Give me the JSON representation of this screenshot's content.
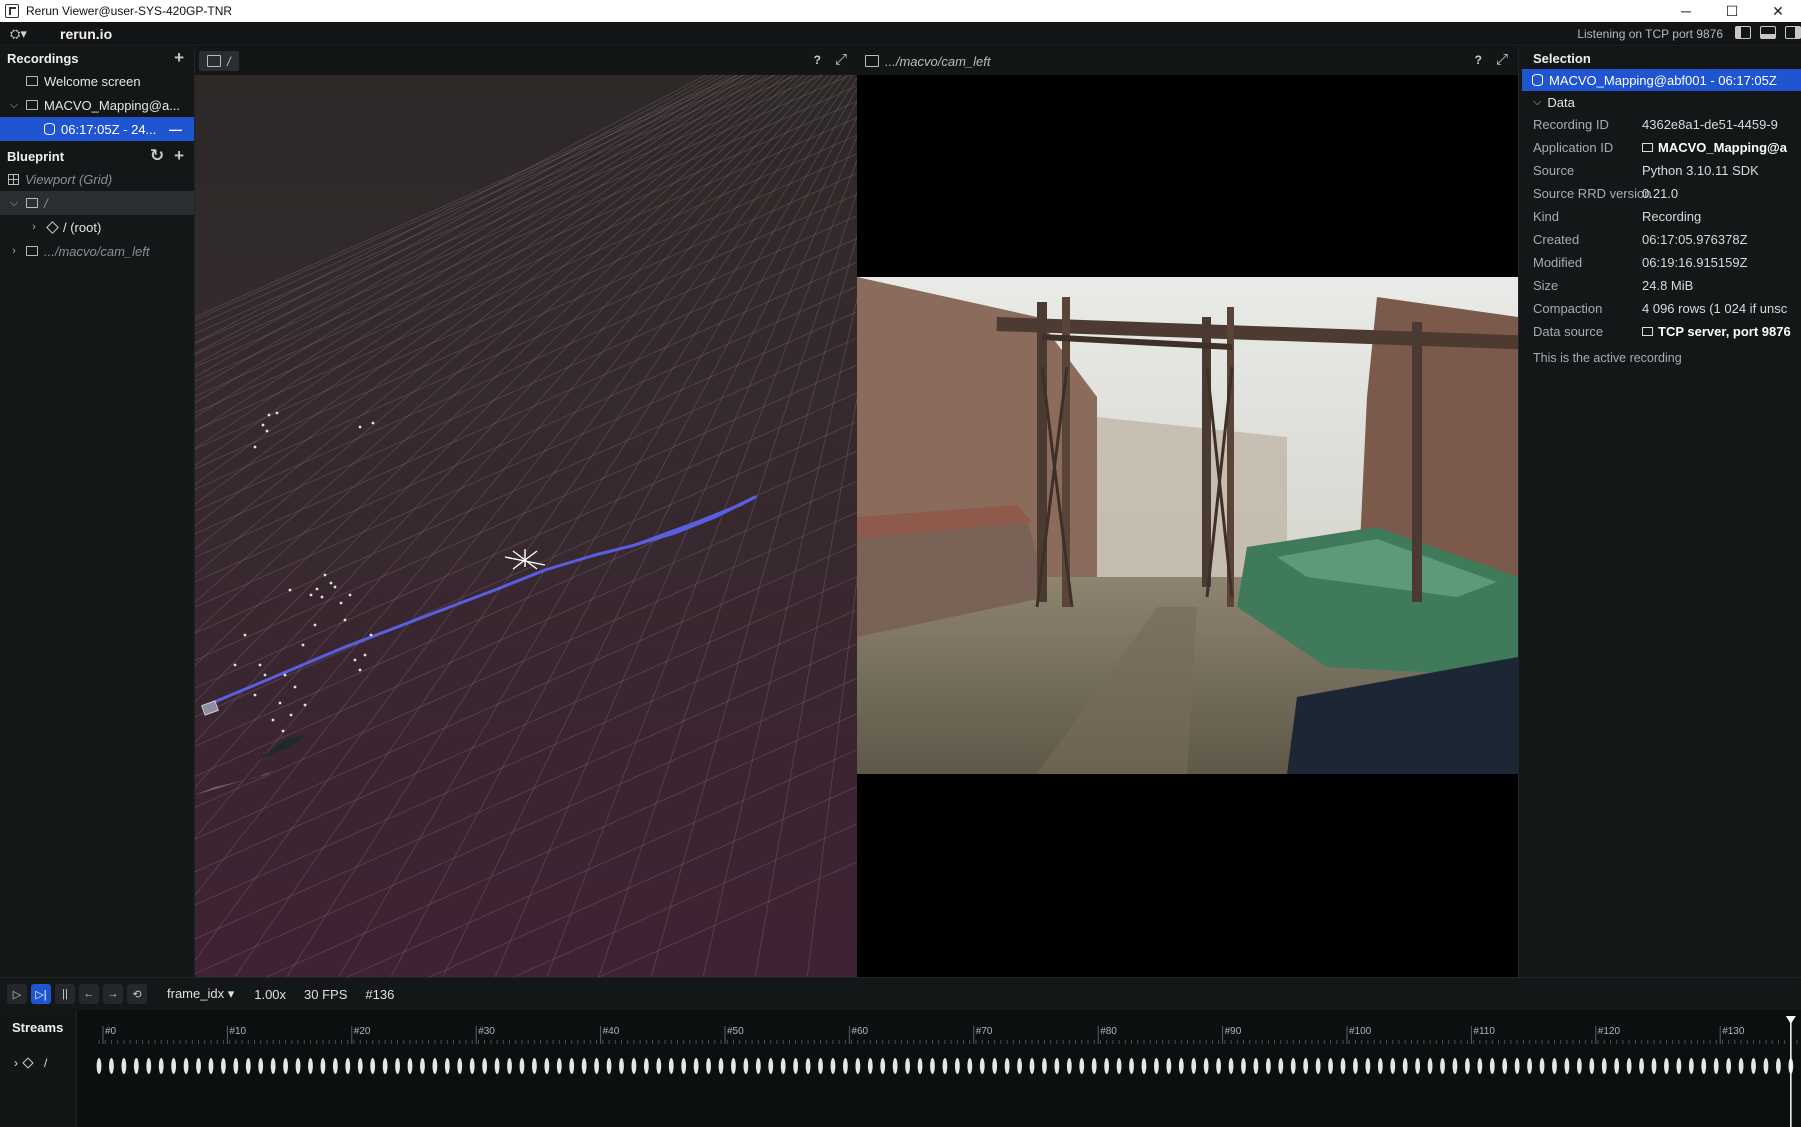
{
  "window": {
    "title": "Rerun Viewer@user-SYS-420GP-TNR",
    "minimize": "─",
    "maximize": "☐",
    "close": "✕"
  },
  "topbar": {
    "brand": "rerun.io",
    "logo_glyph": "⛭▾",
    "status": "Listening on TCP port 9876"
  },
  "recordings": {
    "title": "Recordings",
    "add_glyph": "+",
    "items": [
      {
        "label": "Welcome screen"
      },
      {
        "label": "MACVO_Mapping@a..."
      },
      {
        "label": "06:17:05Z - 24...",
        "trail": "—"
      }
    ]
  },
  "blueprint": {
    "title": "Blueprint",
    "reset_glyph": "↻",
    "add_glyph": "+",
    "viewport": "Viewport (Grid)",
    "items": [
      {
        "label": "/"
      },
      {
        "label": "/ (root)"
      },
      {
        "label": ".../macvo/cam_left"
      }
    ]
  },
  "views": {
    "spatial3d": {
      "tab_label": "/",
      "help": "?",
      "expand": "⤢"
    },
    "camera": {
      "tab_label": ".../macvo/cam_left",
      "help": "?",
      "expand": "⤢"
    }
  },
  "selection": {
    "title": "Selection",
    "selected": "MACVO_Mapping@abf001 - 06:17:05Z",
    "data_header": "Data",
    "properties": [
      {
        "key": "Recording ID",
        "value": "4362e8a1-de51-4459-9"
      },
      {
        "key": "Application ID",
        "value": "MACVO_Mapping@a"
      },
      {
        "key": "Source",
        "value": "Python 3.10.11 SDK"
      },
      {
        "key": "Source RRD version",
        "value": "0.21.0"
      },
      {
        "key": "Kind",
        "value": "Recording"
      },
      {
        "key": "Created",
        "value": "06:17:05.976378Z"
      },
      {
        "key": "Modified",
        "value": "06:19:16.915159Z"
      },
      {
        "key": "Size",
        "value": "24.8 MiB"
      },
      {
        "key": "Compaction",
        "value": "4 096 rows (1 024 if unsc"
      },
      {
        "key": "Data source",
        "value": "TCP server, port 9876"
      }
    ],
    "active_note": "This is the active recording"
  },
  "timeline": {
    "timeline_name": "frame_idx",
    "speed": "1.00x",
    "fps": "30 FPS",
    "current": "#136",
    "streams_label": "Streams",
    "stream_entity": "/",
    "ticks": [
      "#0",
      "#10",
      "#20",
      "#30",
      "#40",
      "#50",
      "#60",
      "#70",
      "#80",
      "#90",
      "#100",
      "#110",
      "#120",
      "#130"
    ],
    "frame_count": 137
  },
  "colors": {
    "accent": "#1f55d0",
    "trajectory": "#5a5ee0",
    "panel_bg": "#141718"
  }
}
